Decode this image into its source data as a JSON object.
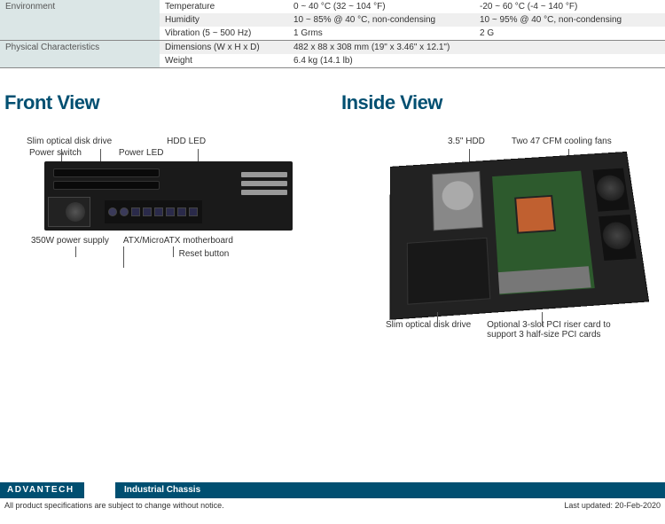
{
  "spec_table": {
    "rows": [
      {
        "cat": "Environment",
        "sub": "Temperature",
        "v1": "0 ~ 40 °C (32 ~ 104 °F)",
        "v2": "-20 ~ 60 °C (-4 ~ 140 °F)"
      },
      {
        "cat": "",
        "sub": "Humidity",
        "v1": "10 ~ 85% @ 40 °C, non-condensing",
        "v2": "10 ~ 95% @ 40 °C, non-condensing"
      },
      {
        "cat": "",
        "sub": "Vibration (5 ~ 500 Hz)",
        "v1": "1 Grms",
        "v2": "2 G"
      },
      {
        "cat": "Physical Characteristics",
        "sub": "Dimensions (W x H x D)",
        "v1": "482 x 88 x 308 mm (19\" x 3.46\" x 12.1\")",
        "v2": ""
      },
      {
        "cat": "",
        "sub": "Weight",
        "v1": "6.4 kg (14.1 lb)",
        "v2": ""
      }
    ]
  },
  "front_view": {
    "title": "Front View",
    "labels": {
      "optical": "Slim optical disk drive",
      "hdd_led": "HDD LED",
      "power_switch": "Power switch",
      "power_led": "Power LED",
      "psu": "350W power supply",
      "mb": "ATX/MicroATX motherboard",
      "reset": "Reset button"
    }
  },
  "inside_view": {
    "title": "Inside View",
    "labels": {
      "hdd": "3.5\" HDD",
      "fans": "Two 47 CFM cooling fans",
      "optical": "Slim optical disk drive",
      "riser": "Optional 3-slot PCI riser card to support 3 half-size PCI cards"
    }
  },
  "footer": {
    "brand": "ADVANTECH",
    "category": "Industrial Chassis",
    "disclaimer": "All product specifications are subject to change without notice.",
    "updated": "Last updated: 20-Feb-2020"
  }
}
